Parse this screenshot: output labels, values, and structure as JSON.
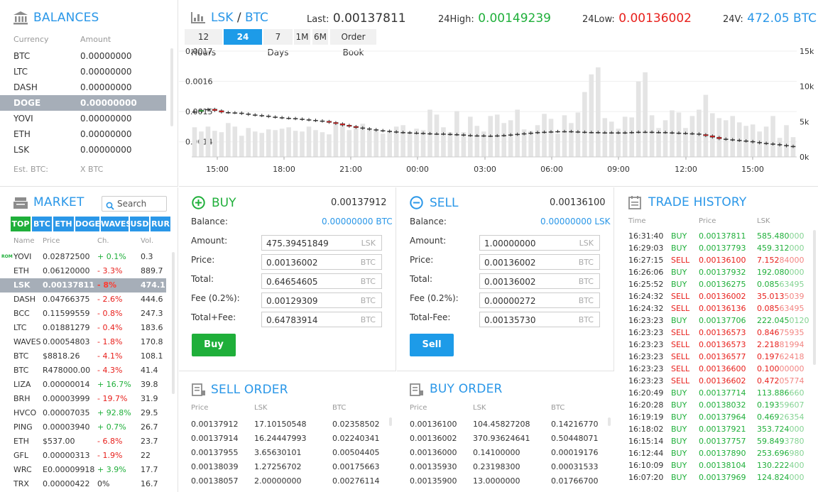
{
  "balances": {
    "title": "BALANCES",
    "col_currency": "Currency",
    "col_amount": "Amount",
    "rows": [
      {
        "currency": "BTC",
        "amount": "0.00000000"
      },
      {
        "currency": "LTC",
        "amount": "0.00000000"
      },
      {
        "currency": "DASH",
        "amount": "0.00000000"
      },
      {
        "currency": "DOGE",
        "amount": "0.00000000"
      },
      {
        "currency": "YOVI",
        "amount": "0.00000000"
      },
      {
        "currency": "ETH",
        "amount": "0.00000000"
      },
      {
        "currency": "LSK",
        "amount": "0.00000000"
      }
    ],
    "selected_index": 3,
    "est_label": "Est. BTC:",
    "est_value": "X BTC"
  },
  "market": {
    "title": "MARKET",
    "search_placeholder": "Search",
    "tabs": [
      "TOP",
      "BTC",
      "ETH",
      "DOGE",
      "WAVES",
      "USD",
      "RUR"
    ],
    "active_tab": 0,
    "col_name": "Name",
    "col_price": "Price",
    "col_change": "Ch.",
    "col_volume": "Vol.",
    "badge_text": "ROM",
    "rows": [
      {
        "name": "YOVI",
        "price": "0.02872500",
        "change": "+ 0.1%",
        "dir": "up",
        "vol": "0.3"
      },
      {
        "name": "ETH",
        "price": "0.06120000",
        "change": "- 3.3%",
        "dir": "down",
        "vol": "889.7"
      },
      {
        "name": "LSK",
        "price": "0.00137811",
        "change": "- 8%",
        "dir": "down",
        "vol": "474.1"
      },
      {
        "name": "DASH",
        "price": "0.04766375",
        "change": "- 2.6%",
        "dir": "down",
        "vol": "444.6"
      },
      {
        "name": "BCC",
        "price": "0.11599559",
        "change": "- 0.8%",
        "dir": "down",
        "vol": "247.3"
      },
      {
        "name": "LTC",
        "price": "0.01881279",
        "change": "- 0.4%",
        "dir": "down",
        "vol": "183.6"
      },
      {
        "name": "WAVES",
        "price": "0.00054803",
        "change": "- 1.8%",
        "dir": "down",
        "vol": "170.8"
      },
      {
        "name": "BTC",
        "price": "$8818.26",
        "change": "- 4.1%",
        "dir": "down",
        "vol": "108.1"
      },
      {
        "name": "BTC",
        "price": "R478000.00",
        "change": "- 4.3%",
        "dir": "down",
        "vol": "41.4"
      },
      {
        "name": "LIZA",
        "price": "0.00000014",
        "change": "+ 16.7%",
        "dir": "up",
        "vol": "39.8"
      },
      {
        "name": "BRH",
        "price": "0.00003999",
        "change": "- 19.7%",
        "dir": "down",
        "vol": "31.9"
      },
      {
        "name": "HVCO",
        "price": "0.00007035",
        "change": "+ 92.8%",
        "dir": "up",
        "vol": "29.5"
      },
      {
        "name": "PING",
        "price": "0.00003940",
        "change": "+ 0.7%",
        "dir": "up",
        "vol": "26.7"
      },
      {
        "name": "ETH",
        "price": "$537.00",
        "change": "- 6.8%",
        "dir": "down",
        "vol": "23.7"
      },
      {
        "name": "GFL",
        "price": "0.00000313",
        "change": "- 1.9%",
        "dir": "down",
        "vol": "22"
      },
      {
        "name": "WRC",
        "price": "E0.00009918",
        "change": "+ 3.9%",
        "dir": "up",
        "vol": "17.7"
      },
      {
        "name": "TRX",
        "price": "0.00000422",
        "change": "0%",
        "dir": "flat",
        "vol": "16.7"
      }
    ],
    "selected_index": 2
  },
  "ticker": {
    "pair_base": "LSK",
    "pair_sep": "/",
    "pair_quote": "BTC",
    "last_label": "Last:",
    "last_value": "0.00137811",
    "high_label": "24High:",
    "high_value": "0.00149239",
    "low_label": "24Low:",
    "low_value": "0.00136002",
    "vol_label": "24V:",
    "vol_value": "472.05 BTC"
  },
  "chart_controls": {
    "ranges": [
      "12 Hours",
      "24 Hours",
      "7 Days",
      "1M",
      "6M",
      "Order Book"
    ],
    "active_index": 1
  },
  "chart_data": {
    "type": "candlestick",
    "y_ticks_price": [
      "0.0017",
      "0.0016",
      "0.0015",
      "0.0014"
    ],
    "y_ticks_volume": [
      "15k",
      "10k",
      "5k",
      "0k"
    ],
    "x_ticks": [
      "15:00",
      "18:00",
      "21:00",
      "00:00",
      "03:00",
      "06:00",
      "09:00",
      "12:00",
      "15:00"
    ],
    "ylim_price": [
      0.00135,
      0.0017
    ],
    "ylim_volume": [
      0,
      15000
    ],
    "colors": {
      "up": "#2fae3a",
      "down": "#e01b1b",
      "volume": "#e4e4e4"
    },
    "price": [
      0.0015,
      0.001505,
      0.001508,
      0.001503,
      0.001498,
      0.001497,
      0.001496,
      0.001493,
      0.00149,
      0.001488,
      0.001486,
      0.001483,
      0.001481,
      0.001479,
      0.001478,
      0.001476,
      0.001474,
      0.001472,
      0.00147,
      0.001468,
      0.001464,
      0.00146,
      0.001455,
      0.001451,
      0.001447,
      0.001444,
      0.001441,
      0.001438,
      0.001436,
      0.001434,
      0.001432,
      0.001431,
      0.00143,
      0.001429,
      0.001428,
      0.001427,
      0.001427,
      0.001426,
      0.001425,
      0.001424,
      0.001422,
      0.001421,
      0.001421,
      0.00142,
      0.00142,
      0.001421,
      0.001422,
      0.001424,
      0.001426,
      0.001428,
      0.00143,
      0.001432,
      0.001433,
      0.001434,
      0.001435,
      0.001435,
      0.001434,
      0.001433,
      0.001432,
      0.001432,
      0.001431,
      0.001431,
      0.001431,
      0.00143,
      0.001431,
      0.001432,
      0.001433,
      0.001433,
      0.001432,
      0.001432,
      0.001431,
      0.00143,
      0.001429,
      0.001428,
      0.001427,
      0.001424,
      0.00142,
      0.001415,
      0.00141,
      0.001408,
      0.001406,
      0.001404,
      0.001402,
      0.001399,
      0.001396,
      0.001394,
      0.001392,
      0.001389,
      0.001386,
      0.001384
    ],
    "volume": [
      4200,
      3600,
      4300,
      3700,
      3500,
      4800,
      4300,
      3000,
      4100,
      3600,
      3400,
      3900,
      3800,
      4000,
      4200,
      3700,
      3600,
      4300,
      3800,
      3500,
      3200,
      4600,
      4400,
      3800,
      4200,
      4700,
      4000,
      3900,
      3300,
      3700,
      4300,
      4500,
      3600,
      4000,
      3800,
      6700,
      6000,
      4200,
      3500,
      6500,
      3500,
      5700,
      4400,
      3600,
      5800,
      6000,
      4800,
      5200,
      6700,
      3900,
      3700,
      4500,
      6100,
      5400,
      3300,
      5900,
      4800,
      6300,
      9200,
      11700,
      12700,
      5500,
      5000,
      4000,
      5700,
      5600,
      10700,
      12000,
      5900,
      4100,
      5200,
      6600,
      6300,
      4100,
      5800,
      6700,
      8800,
      6200,
      5500,
      5200,
      5800,
      4900,
      4400,
      4600,
      3600,
      4300,
      5800,
      2700,
      4500,
      2800
    ]
  },
  "buy": {
    "title": "BUY",
    "price_top": "0.00137912",
    "balance_label": "Balance:",
    "balance_value": "0.00000000 BTC",
    "fields": [
      {
        "label": "Amount:",
        "value": "475.39451849",
        "unit": "LSK"
      },
      {
        "label": "Price:",
        "value": "0.00136002",
        "unit": "BTC"
      },
      {
        "label": "Total:",
        "value": "0.64654605",
        "unit": "BTC"
      },
      {
        "label": "Fee (0.2%):",
        "value": "0.00129309",
        "unit": "BTC"
      },
      {
        "label": "Total+Fee:",
        "value": "0.64783914",
        "unit": "BTC"
      }
    ],
    "button": "Buy",
    "color": "#1faf3a"
  },
  "sell": {
    "title": "SELL",
    "price_top": "0.00136100",
    "balance_label": "Balance:",
    "balance_value": "0.00000000 LSK",
    "fields": [
      {
        "label": "Amount:",
        "value": "1.00000000",
        "unit": "LSK"
      },
      {
        "label": "Price:",
        "value": "0.00136002",
        "unit": "BTC"
      },
      {
        "label": "Total:",
        "value": "0.00136002",
        "unit": "BTC"
      },
      {
        "label": "Fee (0.2%):",
        "value": "0.00000272",
        "unit": "BTC"
      },
      {
        "label": "Total-Fee:",
        "value": "0.00135730",
        "unit": "BTC"
      }
    ],
    "button": "Sell",
    "color": "#1d9be8"
  },
  "sell_order": {
    "title": "SELL ORDER",
    "col_price": "Price",
    "col_amount": "LSK",
    "col_total": "BTC",
    "rows": [
      [
        "0.00137912",
        "17.10150548",
        "0.02358502"
      ],
      [
        "0.00137914",
        "16.24447993",
        "0.02240341"
      ],
      [
        "0.00137955",
        "3.65630101",
        "0.00504405"
      ],
      [
        "0.00138039",
        "1.27256702",
        "0.00175663"
      ],
      [
        "0.00138057",
        "2.00000000",
        "0.00276114"
      ]
    ]
  },
  "buy_order": {
    "title": "BUY ORDER",
    "col_price": "Price",
    "col_amount": "LSK",
    "col_total": "BTC",
    "rows": [
      [
        "0.00136100",
        "104.45827208",
        "0.14216770"
      ],
      [
        "0.00136002",
        "370.93624641",
        "0.50448071"
      ],
      [
        "0.00136000",
        "0.14100000",
        "0.00019176"
      ],
      [
        "0.00135930",
        "0.23198300",
        "0.00031533"
      ],
      [
        "0.00135900",
        "13.0000000",
        "0.01766700"
      ]
    ]
  },
  "trade_history": {
    "title": "TRADE HISTORY",
    "col_time": "Time",
    "col_price": "Price",
    "col_amount": "LSK",
    "rows": [
      {
        "time": "16:31:40",
        "side": "BUY",
        "price": "0.00137811",
        "amt_a": "585.480",
        "amt_b": "000"
      },
      {
        "time": "16:29:03",
        "side": "BUY",
        "price": "0.00137793",
        "amt_a": "459.312",
        "amt_b": "000"
      },
      {
        "time": "16:27:15",
        "side": "SELL",
        "price": "0.00136100",
        "amt_a": "7.152",
        "amt_b": "84000"
      },
      {
        "time": "16:26:06",
        "side": "BUY",
        "price": "0.00137932",
        "amt_a": "192.080",
        "amt_b": "000"
      },
      {
        "time": "16:25:52",
        "side": "BUY",
        "price": "0.00136275",
        "amt_a": "0.085",
        "amt_b": "63495"
      },
      {
        "time": "16:24:32",
        "side": "SELL",
        "price": "0.00136002",
        "amt_a": "35.013",
        "amt_b": "5039"
      },
      {
        "time": "16:24:32",
        "side": "SELL",
        "price": "0.00136136",
        "amt_a": "0.085",
        "amt_b": "63495"
      },
      {
        "time": "16:23:23",
        "side": "BUY",
        "price": "0.00137706",
        "amt_a": "222.045",
        "amt_b": "0120"
      },
      {
        "time": "16:23:23",
        "side": "SELL",
        "price": "0.00136573",
        "amt_a": "0.846",
        "amt_b": "75935"
      },
      {
        "time": "16:23:23",
        "side": "SELL",
        "price": "0.00136573",
        "amt_a": "2.218",
        "amt_b": "81994"
      },
      {
        "time": "16:23:23",
        "side": "SELL",
        "price": "0.00136577",
        "amt_a": "0.197",
        "amt_b": "62418"
      },
      {
        "time": "16:23:23",
        "side": "SELL",
        "price": "0.00136600",
        "amt_a": "0.100",
        "amt_b": "00000"
      },
      {
        "time": "16:23:23",
        "side": "SELL",
        "price": "0.00136602",
        "amt_a": "0.472",
        "amt_b": "05774"
      },
      {
        "time": "16:20:49",
        "side": "BUY",
        "price": "0.00137714",
        "amt_a": "113.886",
        "amt_b": "660"
      },
      {
        "time": "16:20:28",
        "side": "BUY",
        "price": "0.00138032",
        "amt_a": "0.193",
        "amt_b": "59607"
      },
      {
        "time": "16:19:19",
        "side": "BUY",
        "price": "0.00137964",
        "amt_a": "0.469",
        "amt_b": "26354"
      },
      {
        "time": "16:18:02",
        "side": "BUY",
        "price": "0.00137921",
        "amt_a": "353.724",
        "amt_b": "000"
      },
      {
        "time": "16:15:14",
        "side": "BUY",
        "price": "0.00137757",
        "amt_a": "59.849",
        "amt_b": "3780"
      },
      {
        "time": "16:12:44",
        "side": "BUY",
        "price": "0.00137890",
        "amt_a": "253.696",
        "amt_b": "980"
      },
      {
        "time": "16:10:09",
        "side": "BUY",
        "price": "0.00138104",
        "amt_a": "130.222",
        "amt_b": "400"
      },
      {
        "time": "16:07:20",
        "side": "BUY",
        "price": "0.00137969",
        "amt_a": "124.824",
        "amt_b": "000"
      }
    ]
  }
}
